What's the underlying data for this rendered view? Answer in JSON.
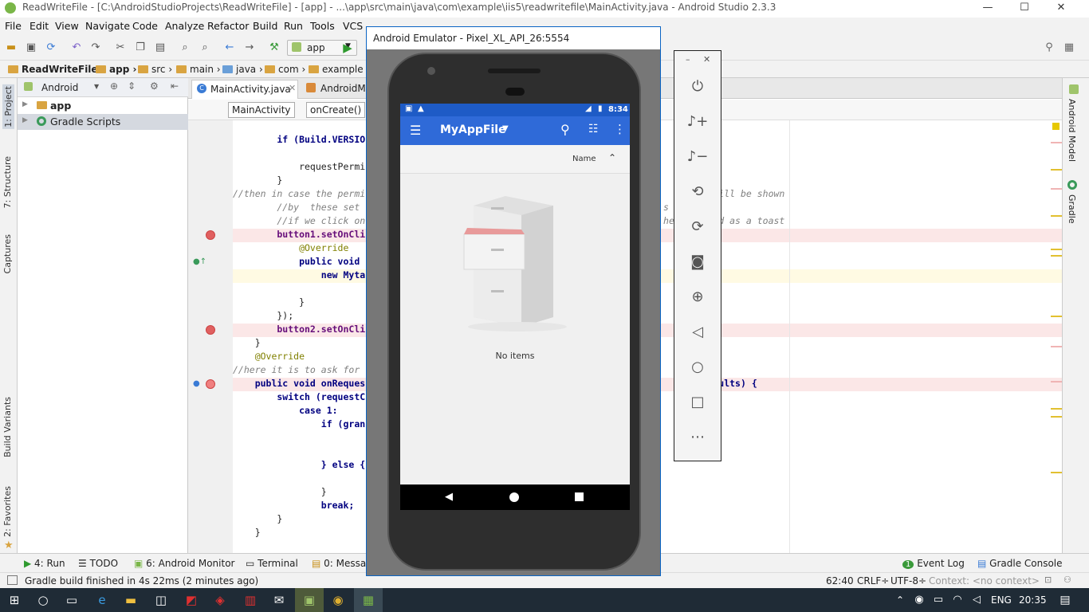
{
  "titlebar": {
    "title": "ReadWriteFile - [C:\\AndroidStudioProjects\\ReadWriteFile] - [app] - ...\\app\\src\\main\\java\\com\\example\\iis5\\readwritefile\\MainActivity.java - Android Studio 2.3.3",
    "minimize": "—",
    "maximize": "☐",
    "close": "✕"
  },
  "menu": [
    "File",
    "Edit",
    "View",
    "Navigate",
    "Code",
    "Analyze",
    "Refactor",
    "Build",
    "Run",
    "Tools",
    "VCS",
    "Window",
    "Help"
  ],
  "toolbar": {
    "run_config": "app"
  },
  "breadcrumb": [
    "ReadWriteFile",
    "app",
    "src",
    "main",
    "java",
    "com",
    "example"
  ],
  "left_tabs": [
    "1: Project",
    "7: Structure",
    "Captures",
    "Build Variants",
    "2: Favorites"
  ],
  "right_tabs": [
    "Android Model",
    "Gradle"
  ],
  "project": {
    "view": "Android",
    "items": [
      {
        "label": "app",
        "bold": true
      },
      {
        "label": "Gradle Scripts",
        "bold": false
      }
    ]
  },
  "editor": {
    "tabs": [
      "MainActivity.java",
      "AndroidM"
    ],
    "crumbs": [
      "MainActivity",
      "onCreate()"
    ],
    "lines": [
      {
        "t": "        if (Build.VERSIO"
      },
      {
        "t": ""
      },
      {
        "t": "            requestPermi"
      },
      {
        "t": "        }"
      },
      {
        "t": "//then in case the permi                                                   fr     file will be shown"
      },
      {
        "t": "        //by  these set                                                       s"
      },
      {
        "t": "        //if we click on                                                      he    found as a toast"
      },
      {
        "t": "        button1.setOnCli"
      },
      {
        "t": "            @Override"
      },
      {
        "t": "            public void"
      },
      {
        "t": "                new Myta"
      },
      {
        "t": ""
      },
      {
        "t": "            }"
      },
      {
        "t": "        });"
      },
      {
        "t": "        button2.setOnCli"
      },
      {
        "t": "    }"
      },
      {
        "t": "    @Override"
      },
      {
        "t": "//here it is to ask for"
      },
      {
        "t": "    public void onReques                                                  s[    grantResults) {"
      },
      {
        "t": "        switch (requestC"
      },
      {
        "t": "            case 1:"
      },
      {
        "t": "                if (gran"
      },
      {
        "t": ""
      },
      {
        "t": ""
      },
      {
        "t": "                } else {"
      },
      {
        "t": ""
      },
      {
        "t": "                }"
      },
      {
        "t": "                break;"
      },
      {
        "t": "        }"
      },
      {
        "t": "    }"
      }
    ]
  },
  "bottom_tabs": [
    "4: Run",
    "TODO",
    "6: Android Monitor",
    "Terminal",
    "0: Messag",
    "Event Log",
    "Gradle Console"
  ],
  "status": {
    "message": "Gradle build finished in 4s 22ms (2 minutes ago)",
    "position": "62:40",
    "line_sep": "CRLF÷",
    "encoding": "UTF-8÷",
    "context": "Context: <no context>"
  },
  "emulator": {
    "title": "Android Emulator - Pixel_XL_API_26:5554",
    "time": "8:34",
    "app_title": "MyAppFile",
    "sort_label": "Name",
    "empty_text": "No items"
  },
  "taskbar": {
    "lang": "ENG",
    "time": "20:35"
  },
  "colors": {
    "accent": "#2f6ad8",
    "statusbar": "#1e5bc6",
    "breakpoint": "#e06060"
  }
}
